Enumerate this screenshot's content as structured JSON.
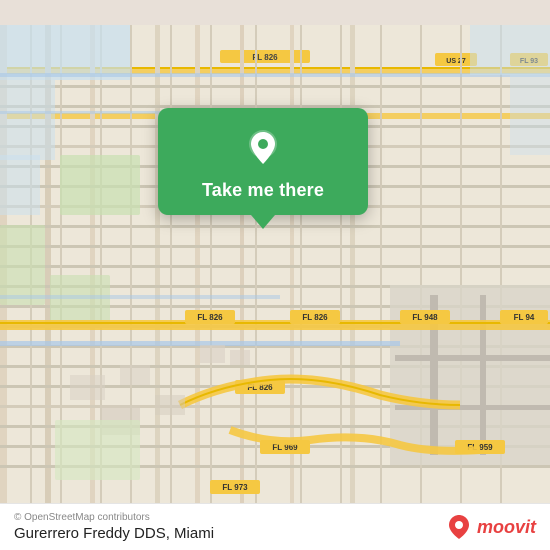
{
  "map": {
    "background_color": "#e8e0d8",
    "attribution": "© OpenStreetMap contributors"
  },
  "popup": {
    "button_label": "Take me there",
    "pin_color": "#fff"
  },
  "bottom_bar": {
    "osm_credit": "© OpenStreetMap contributors",
    "location_name": "Gurerrero Freddy DDS, Miami",
    "moovit_label": "moovit"
  }
}
